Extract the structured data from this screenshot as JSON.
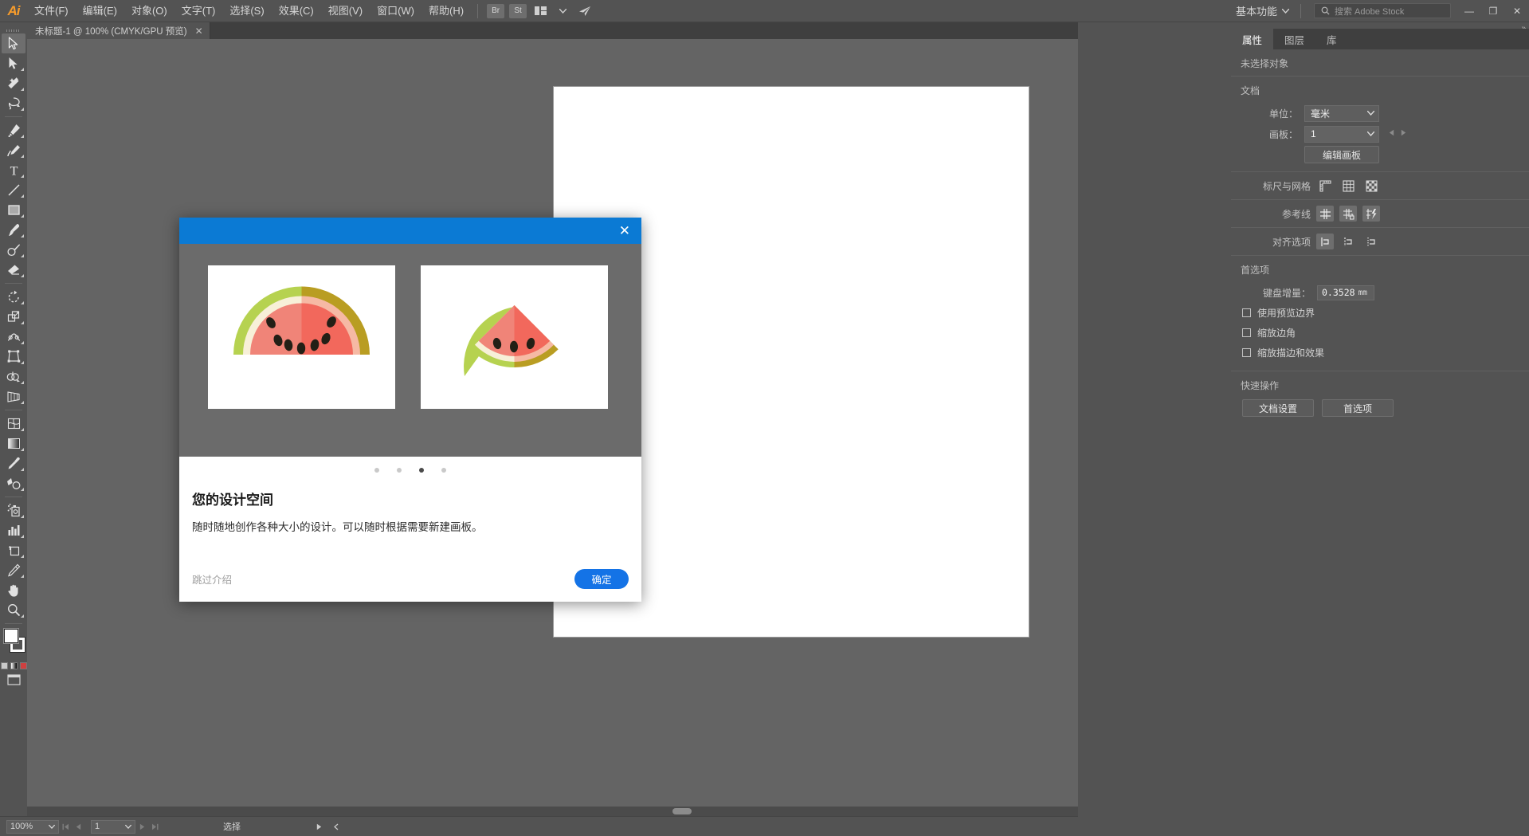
{
  "app": {
    "logo_text": "Ai"
  },
  "menubar": {
    "items": [
      {
        "label": "文件(F)",
        "name": "menu-file"
      },
      {
        "label": "编辑(E)",
        "name": "menu-edit"
      },
      {
        "label": "对象(O)",
        "name": "menu-object"
      },
      {
        "label": "文字(T)",
        "name": "menu-type"
      },
      {
        "label": "选择(S)",
        "name": "menu-select"
      },
      {
        "label": "效果(C)",
        "name": "menu-effect"
      },
      {
        "label": "视图(V)",
        "name": "menu-view"
      },
      {
        "label": "窗口(W)",
        "name": "menu-window"
      },
      {
        "label": "帮助(H)",
        "name": "menu-help"
      }
    ],
    "bridge_label": "Br",
    "stock_label": "St",
    "arrange_icon": "arrange-documents-icon",
    "share_icon": "share-icon",
    "workspace": "基本功能",
    "search_placeholder": "搜索 Adobe Stock",
    "minimize": "—",
    "restore": "❐",
    "close": "✕"
  },
  "tabbar": {
    "title": "未标题-1 @ 100% (CMYK/GPU 预览)",
    "close": "✕"
  },
  "toolbar": {
    "tools": [
      {
        "name": "selection-tool",
        "label": "选择工具"
      },
      {
        "name": "direct-selection-tool",
        "label": "直接选择工具"
      },
      {
        "name": "magic-wand-tool",
        "label": "魔棒工具"
      },
      {
        "name": "lasso-tool",
        "label": "套索工具"
      },
      {
        "name": "pen-tool",
        "label": "钢笔工具"
      },
      {
        "name": "curvature-tool",
        "label": "曲率工具"
      },
      {
        "name": "type-tool",
        "label": "文字工具"
      },
      {
        "name": "line-segment-tool",
        "label": "直线段工具"
      },
      {
        "name": "rectangle-tool",
        "label": "矩形工具"
      },
      {
        "name": "paintbrush-tool",
        "label": "画笔工具"
      },
      {
        "name": "blob-brush-tool",
        "label": "斑点画笔工具"
      },
      {
        "name": "eraser-tool",
        "label": "橡皮擦工具"
      },
      {
        "name": "rotate-tool",
        "label": "旋转工具"
      },
      {
        "name": "scale-tool",
        "label": "比例缩放工具"
      },
      {
        "name": "width-tool",
        "label": "宽度工具"
      },
      {
        "name": "free-transform-tool",
        "label": "自由变换工具"
      },
      {
        "name": "shape-builder-tool",
        "label": "形状生成器工具"
      },
      {
        "name": "perspective-grid-tool",
        "label": "透视网格工具"
      },
      {
        "name": "mesh-tool",
        "label": "网格工具"
      },
      {
        "name": "gradient-tool",
        "label": "渐变工具"
      },
      {
        "name": "eyedropper-tool",
        "label": "吸管工具"
      },
      {
        "name": "blend-tool",
        "label": "混合工具"
      },
      {
        "name": "symbol-sprayer-tool",
        "label": "符号喷枪工具"
      },
      {
        "name": "column-graph-tool",
        "label": "柱形图工具"
      },
      {
        "name": "artboard-tool",
        "label": "画板工具"
      },
      {
        "name": "slice-tool",
        "label": "切片工具"
      },
      {
        "name": "hand-tool",
        "label": "抓手工具"
      },
      {
        "name": "zoom-tool",
        "label": "缩放工具"
      }
    ],
    "fill_color": "#ffffff",
    "stroke_color": "#000000",
    "screen_mode": "change-screen-mode-icon"
  },
  "statusbar": {
    "zoom": "100%",
    "artboard": "1",
    "status_text": "选择",
    "first_icon": "first-artboard-icon",
    "prev_icon": "previous-artboard-icon",
    "next_icon": "next-artboard-icon",
    "last_icon": "last-artboard-icon"
  },
  "rightpanel": {
    "tabs": [
      {
        "label": "属性",
        "name": "tab-properties",
        "active": true
      },
      {
        "label": "图层",
        "name": "tab-layers",
        "active": false
      },
      {
        "label": "库",
        "name": "tab-libraries",
        "active": false
      }
    ],
    "no_selection": "未选择对象",
    "document": {
      "section_title": "文档",
      "units_label": "单位：",
      "units_value": "毫米",
      "artboard_label": "画板：",
      "artboard_value": "1",
      "edit_artboards": "编辑画板"
    },
    "rulers": {
      "label": "标尺与网格",
      "icons": [
        "show-rulers-icon",
        "show-grid-icon",
        "show-transparency-grid-icon"
      ]
    },
    "guides": {
      "label": "参考线",
      "icons": [
        "show-guides-icon",
        "lock-guides-icon",
        "smart-guides-icon"
      ]
    },
    "align": {
      "label": "对齐选项",
      "icons": [
        "align-to-selection-icon",
        "align-to-key-object-icon",
        "align-to-artboard-icon"
      ]
    },
    "preferences": {
      "section_title": "首选项",
      "keyboard_increment_label": "键盘增量：",
      "keyboard_increment_value": "0.3528",
      "keyboard_increment_unit": "mm",
      "checkboxes": [
        {
          "label": "使用预览边界",
          "checked": false,
          "name": "use-preview-bounds-checkbox"
        },
        {
          "label": "缩放边角",
          "checked": false,
          "name": "scale-corners-checkbox"
        },
        {
          "label": "缩放描边和效果",
          "checked": false,
          "name": "scale-strokes-effects-checkbox"
        }
      ]
    },
    "quick_actions": {
      "section_title": "快速操作",
      "buttons": [
        {
          "label": "文档设置",
          "name": "document-setup-button"
        },
        {
          "label": "首选项",
          "name": "preferences-button"
        }
      ]
    }
  },
  "modal": {
    "close_label": "✕",
    "dots": [
      {
        "active": false
      },
      {
        "active": false
      },
      {
        "active": true
      },
      {
        "active": false
      }
    ],
    "title": "您的设计空间",
    "description": "随时随地创作各种大小的设计。可以随时根据需要新建画板。",
    "skip_label": "跳过介绍",
    "ok_label": "确定",
    "images": [
      {
        "name": "watermelon-half-illustration",
        "alt": "半个西瓜插图"
      },
      {
        "name": "watermelon-wedge-illustration",
        "alt": "西瓜块插图"
      }
    ]
  },
  "colors": {
    "accent_blue": "#1473e6",
    "header_blue": "#0b7ad4",
    "panel_gray": "#535353",
    "canvas_gray": "#646464",
    "watermelon_flesh_light": "#f08478",
    "watermelon_flesh_dark": "#f2685c",
    "watermelon_white_light": "#f7f0d8",
    "watermelon_white_dark": "#f6b9a4",
    "watermelon_rind_light": "#b6d250",
    "watermelon_rind_dark": "#b99d22",
    "seed": "#231f16"
  }
}
